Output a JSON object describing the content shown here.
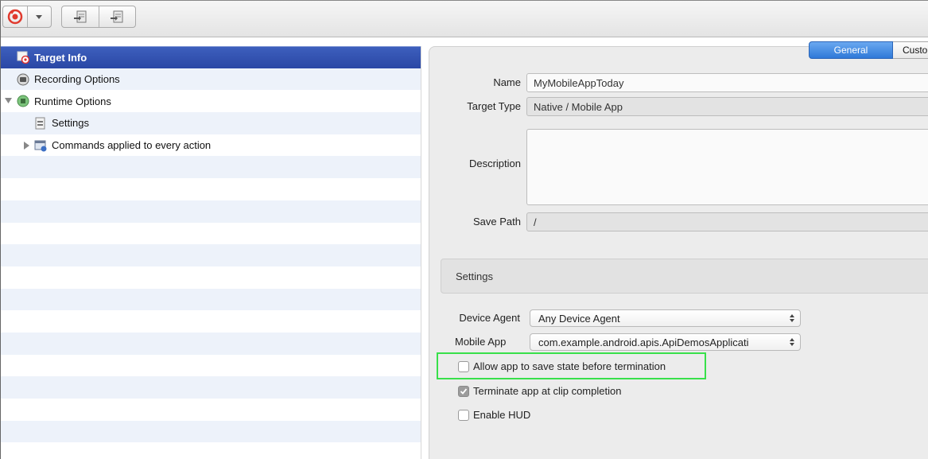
{
  "toolbar": {
    "record_button": "record-icon",
    "dropdown_button": "chevron-down-icon",
    "import_button": "import-icon",
    "export_button": "export-icon"
  },
  "tree": {
    "items": [
      {
        "label": "Target Info",
        "icon": "target-icon",
        "selected": true
      },
      {
        "label": "Recording Options",
        "icon": "recording-icon"
      },
      {
        "label": "Runtime Options",
        "icon": "runtime-icon",
        "expanded": true
      },
      {
        "label": "Settings",
        "icon": "settings-icon"
      },
      {
        "label": "Commands applied to every action",
        "icon": "commands-icon",
        "expanded": false
      }
    ]
  },
  "tabs": {
    "general": "General",
    "custom": "Custo"
  },
  "form": {
    "name_label": "Name",
    "name_value": "MyMobileAppToday",
    "target_type_label": "Target Type",
    "target_type_value": "Native / Mobile App",
    "description_label": "Description",
    "description_value": "",
    "save_path_label": "Save Path",
    "save_path_value": "/"
  },
  "settings": {
    "header": "Settings",
    "device_agent_label": "Device Agent",
    "device_agent_value": "Any Device Agent",
    "mobile_app_label": "Mobile App",
    "mobile_app_value": "com.example.android.apis.ApiDemosApplicati",
    "allow_save_state": {
      "label": "Allow app to save state before termination",
      "checked": false
    },
    "terminate_app": {
      "label": "Terminate app at clip completion",
      "checked": true
    },
    "enable_hud": {
      "label": "Enable HUD",
      "checked": false
    }
  },
  "colors": {
    "selection": "#2f4fae",
    "active_tab": "#2f79d8",
    "highlight": "#38e04a"
  }
}
